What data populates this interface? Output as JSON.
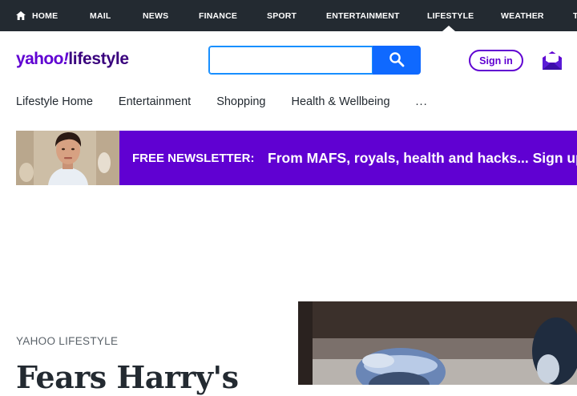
{
  "topnav": {
    "items": [
      {
        "label": "HOME",
        "icon": "home-icon"
      },
      {
        "label": "MAIL"
      },
      {
        "label": "NEWS"
      },
      {
        "label": "FINANCE"
      },
      {
        "label": "SPORT"
      },
      {
        "label": "ENTERTAINMENT"
      },
      {
        "label": "LIFESTYLE",
        "active": true
      },
      {
        "label": "WEATHER"
      },
      {
        "label": "T"
      }
    ],
    "background": "#232a31"
  },
  "header": {
    "logo": {
      "brand": "yahoo",
      "slash": "!",
      "section": "lifestyle"
    },
    "search": {
      "value": "",
      "placeholder": "",
      "button_icon": "search-icon"
    },
    "signin_label": "Sign in",
    "mail_icon": "mail-icon"
  },
  "subnav": {
    "items": [
      {
        "label": "Lifestyle Home"
      },
      {
        "label": "Entertainment"
      },
      {
        "label": "Shopping"
      },
      {
        "label": "Health & Wellbeing"
      }
    ],
    "more_label": "..."
  },
  "newsletter": {
    "label": "FREE NEWSLETTER:",
    "text": "From MAFS, royals, health and hacks... Sign up",
    "background": "#6001d2"
  },
  "article": {
    "section": "YAHOO LIFESTYLE",
    "headline": "Fears Harry's"
  },
  "colors": {
    "brand_purple": "#6001d2",
    "search_blue": "#0f69ff",
    "text_dark": "#232a31",
    "text_muted": "#5b636a"
  }
}
